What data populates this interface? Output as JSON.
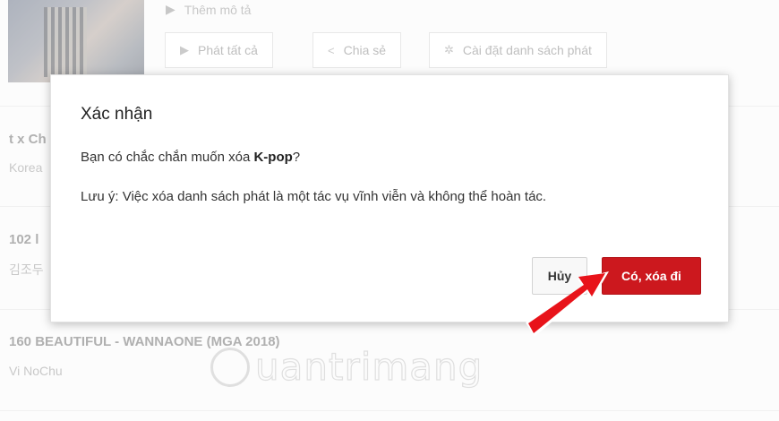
{
  "background": {
    "add_description": "Thêm mô tả",
    "buttons": [
      {
        "label": "Phát tất cả",
        "icon": "play-icon"
      },
      {
        "label": "Chia sẻ",
        "icon": "share-icon"
      },
      {
        "label": "Cài đặt danh sách phát",
        "icon": "gear-icon"
      }
    ],
    "rows": [
      {
        "title": "t x Ch",
        "subtitle": "Korea"
      },
      {
        "title": "102 l",
        "subtitle": "김조두"
      },
      {
        "title": "160 BEAUTIFUL - WANNAONE (MGA 2018)",
        "subtitle": "Vi NoChu"
      }
    ],
    "watermark": "uantrimang"
  },
  "dialog": {
    "title": "Xác nhận",
    "question_prefix": "Bạn có chắc chắn muốn xóa ",
    "playlist_name": "K-pop",
    "question_suffix": "?",
    "note": "Lưu ý: Việc xóa danh sách phát là một tác vụ vĩnh viễn và không thể hoàn tác.",
    "cancel_label": "Hủy",
    "confirm_label": "Có, xóa đi"
  },
  "colors": {
    "confirm_button": "#cc181e",
    "arrow": "#e8131a"
  }
}
